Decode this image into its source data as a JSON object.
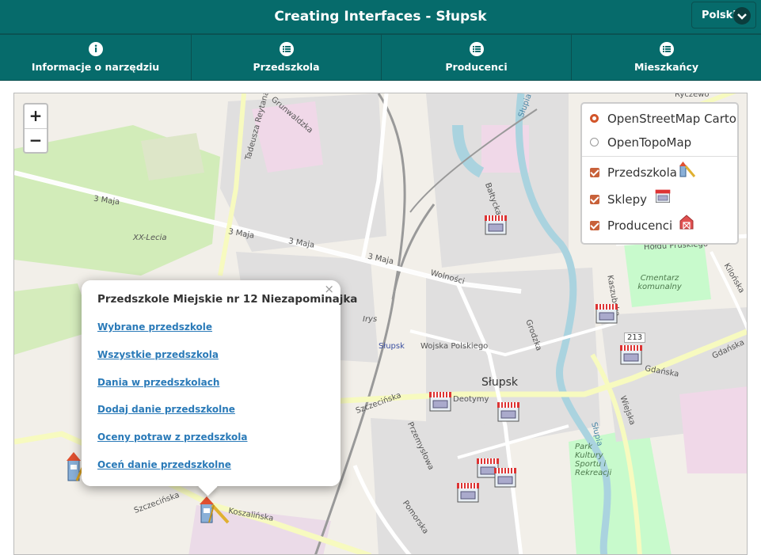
{
  "header": {
    "title": "Creating Interfaces - Słupsk",
    "language": "Polski"
  },
  "nav": {
    "tabs": [
      {
        "label": "Informacje o narzędziu",
        "icon": "info-icon"
      },
      {
        "label": "Przedszkola",
        "icon": "list-icon"
      },
      {
        "label": "Producenci",
        "icon": "list-icon"
      },
      {
        "label": "Mieszkańcy",
        "icon": "list-icon"
      }
    ]
  },
  "map": {
    "zoom_in": "+",
    "zoom_out": "−",
    "base_layers": [
      {
        "label": "OpenStreetMap Carto",
        "selected": true
      },
      {
        "label": "OpenTopoMap",
        "selected": false
      }
    ],
    "overlays": [
      {
        "label": "Przedszkola",
        "checked": true,
        "icon": "playground-icon"
      },
      {
        "label": "Sklepy",
        "checked": true,
        "icon": "shop-icon"
      },
      {
        "label": "Producenci",
        "checked": true,
        "icon": "barn-icon"
      }
    ],
    "popup": {
      "title": "Przedszkole Miejskie nr 12 Niezapominajka",
      "close": "×",
      "links": [
        "Wybrane przedszkole",
        "Wszystkie przedszkola",
        "Dania w przedszkolach",
        "Dodaj danie przedszkolne",
        "Oceny potraw z przedszkola",
        "Oceń danie przedszkolne"
      ]
    },
    "labels": {
      "city": "Słupsk",
      "station": "Słupsk",
      "street_3maja_a": "3 Maja",
      "street_3maja_b": "3 Maja",
      "street_3maja_c": "3 Maja",
      "street_3maja_d": "3 Maja",
      "street_grunwaldzka": "Grunwaldzka",
      "street_tadeusza": "Tadeusza Reytana",
      "street_wolnosci": "Wolności",
      "street_wojska": "Wojska Polskiego",
      "street_szczecinska": "Szczecińska",
      "street_szczecinska2": "Szczecińska",
      "street_koszalinska": "Koszalińska",
      "street_deotymy": "Deotymy",
      "street_grodzka": "Grodzka",
      "street_gdanska": "Gdańska",
      "street_gdanska2": "Gdańska",
      "street_przemyslowa": "Przemysłowa",
      "street_pomorska": "Pomorska",
      "street_baltycka": "Bałtycka",
      "street_holdu": "Hołdu Pruskiego",
      "street_kilonska": "Kilońska",
      "street_kaszubska": "Kaszubska",
      "street_wiejska": "Wiejska",
      "street_slupia": "Słupia",
      "street_slupia2": "Słupia",
      "area_xxlecia": "XX-Lecia",
      "area_irys": "Irys",
      "cemetery": "Cmentarz komunalny",
      "park": "Park Kultury Sportu i Rekreacji",
      "road_213": "213",
      "rycerzewo": "Ryczewo"
    },
    "colors": {
      "header": "#066b6b",
      "accent_orange": "#c8613a",
      "link": "#2a7ab8",
      "park_green": "#cdebb0",
      "residential": "#e0dfdf",
      "water": "#aad3df",
      "road_yellow": "#f7fabf"
    }
  }
}
